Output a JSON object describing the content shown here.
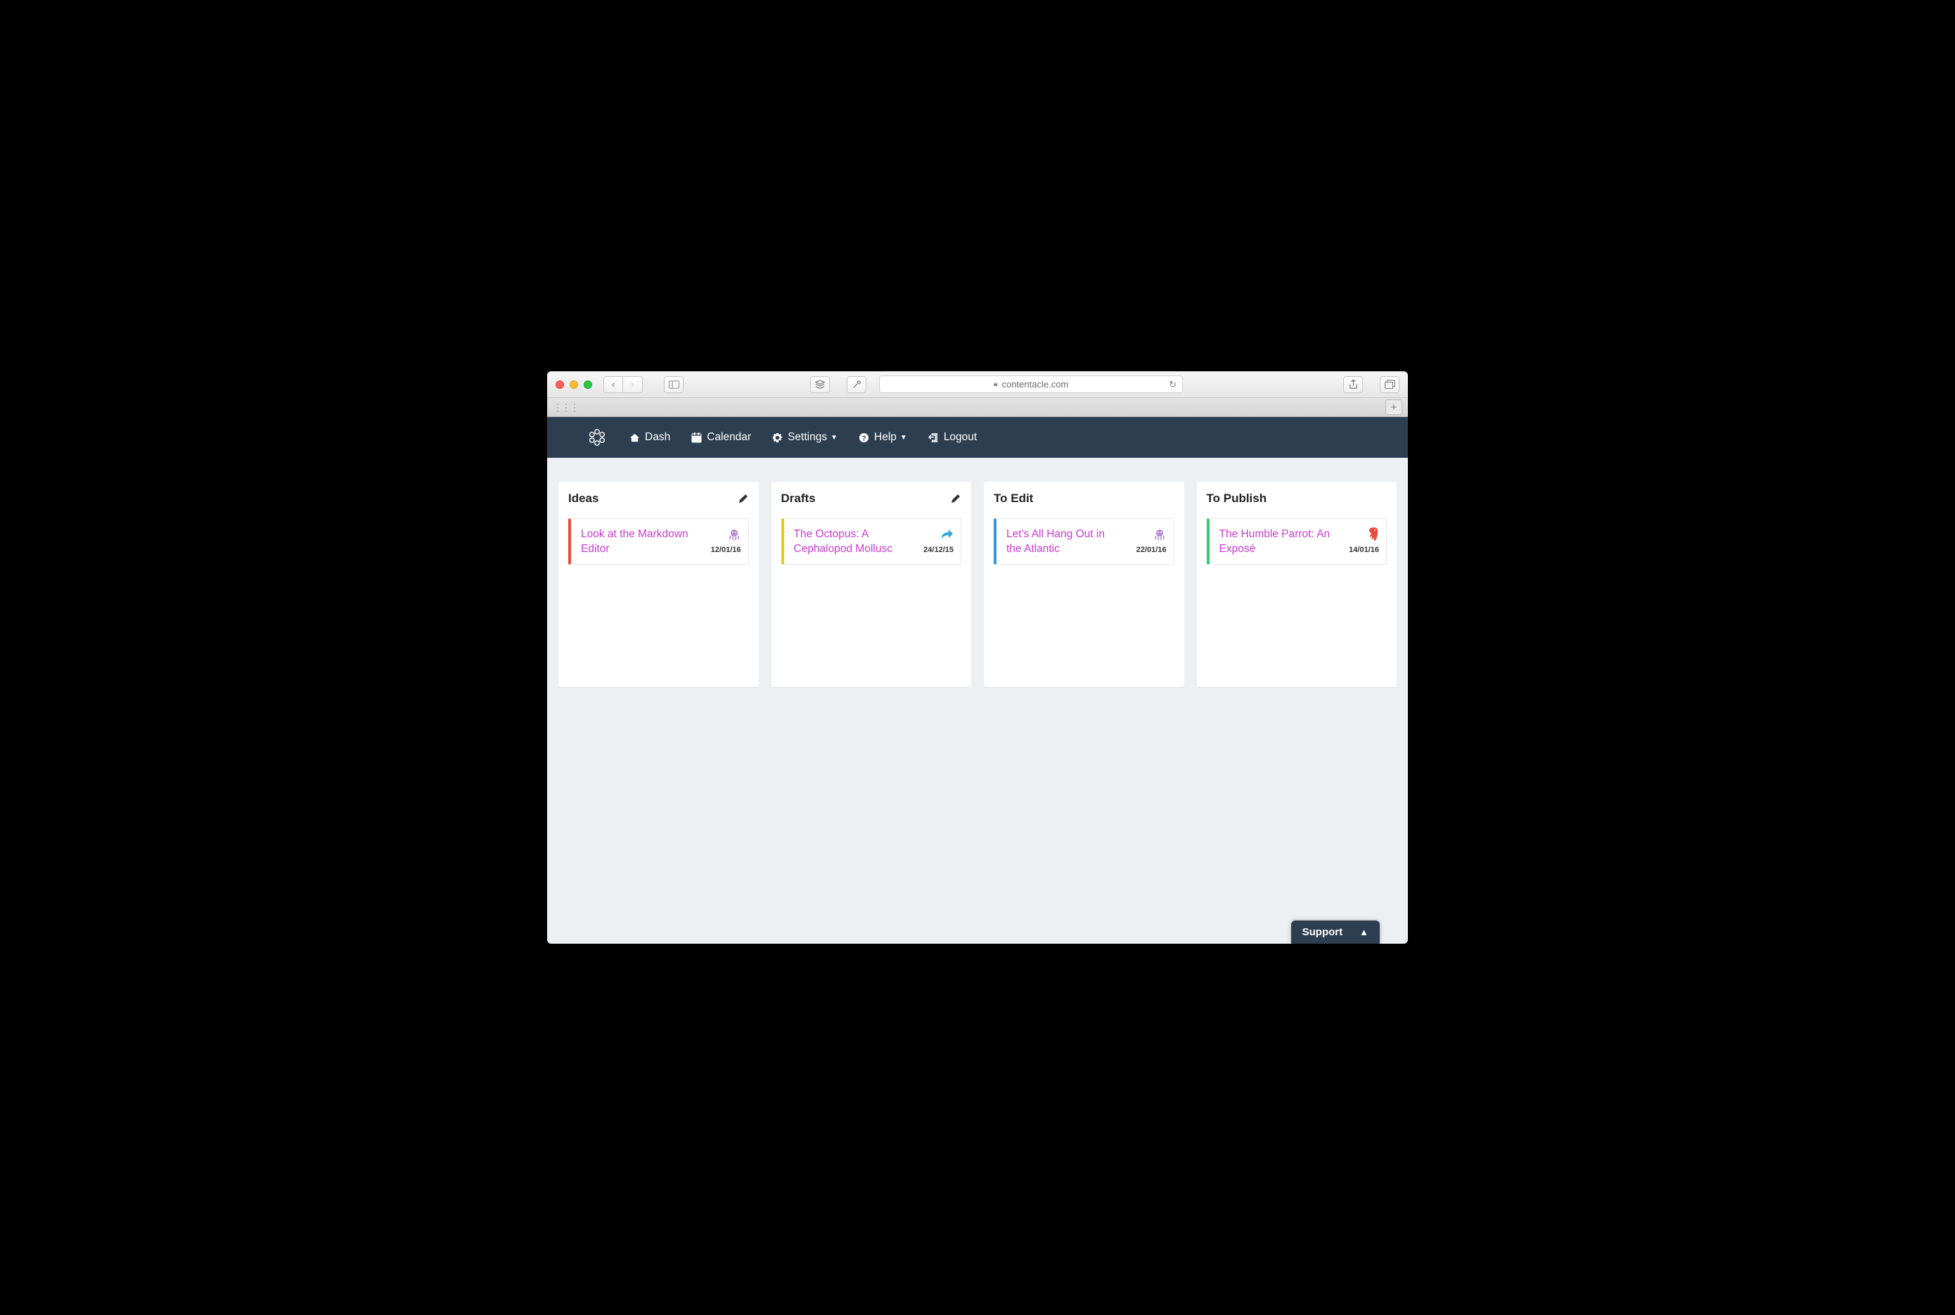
{
  "browser": {
    "url_host": "contentacle.com"
  },
  "nav": {
    "dash": "Dash",
    "calendar": "Calendar",
    "settings": "Settings",
    "help": "Help",
    "logout": "Logout"
  },
  "columns": [
    {
      "title": "Ideas",
      "editable": true,
      "accent": "red",
      "card": {
        "title": "Look at the Markdown Editor",
        "date": "12/01/16",
        "type_icon": "octopus"
      }
    },
    {
      "title": "Drafts",
      "editable": true,
      "accent": "yellow",
      "card": {
        "title": "The Octopus: A Cephalopod Mollusc",
        "date": "24/12/15",
        "type_icon": "share-arrow"
      }
    },
    {
      "title": "To Edit",
      "editable": false,
      "accent": "blue",
      "card": {
        "title": "Let's All Hang Out in the Atlantic",
        "date": "22/01/16",
        "type_icon": "octopus"
      }
    },
    {
      "title": "To Publish",
      "editable": false,
      "accent": "green",
      "card": {
        "title": "The Humble Parrot: An Exposé",
        "date": "14/01/16",
        "type_icon": "parrot"
      }
    }
  ],
  "support": {
    "label": "Support"
  }
}
